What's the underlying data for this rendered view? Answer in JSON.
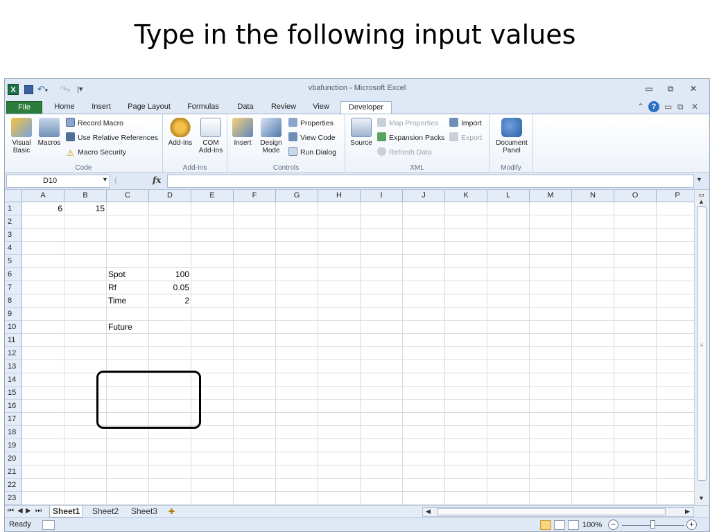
{
  "slide": {
    "title": "Type in the following input values"
  },
  "window": {
    "title": "vbafunction - Microsoft Excel",
    "quick_access": {
      "app_icon": "X",
      "undo_arrow": "▾",
      "redo_arrow": "▾",
      "customize": "|▾"
    },
    "controls": {
      "minimize": "▭",
      "restore": "⧉",
      "close": "✕"
    }
  },
  "ribbon": {
    "tabs": [
      {
        "label": "File"
      },
      {
        "label": "Home"
      },
      {
        "label": "Insert"
      },
      {
        "label": "Page Layout"
      },
      {
        "label": "Formulas"
      },
      {
        "label": "Data"
      },
      {
        "label": "Review"
      },
      {
        "label": "View"
      },
      {
        "label": "Developer"
      }
    ],
    "active_tab": "Developer",
    "right_controls": {
      "minimize_ribbon": "⌃",
      "help": "?",
      "doc_min": "▭",
      "doc_restore": "⧉",
      "doc_close": "✕"
    },
    "groups": {
      "code": {
        "label": "Code",
        "visual_basic": "Visual Basic",
        "macros": "Macros",
        "record_macro": "Record Macro",
        "relative_refs": "Use Relative References",
        "macro_security": "Macro Security"
      },
      "addins": {
        "label": "Add-Ins",
        "addins_btn": "Add-Ins",
        "com_addins": "COM Add-Ins"
      },
      "controls": {
        "label": "Controls",
        "insert": "Insert",
        "design_mode": "Design Mode",
        "properties": "Properties",
        "view_code": "View Code",
        "run_dialog": "Run Dialog"
      },
      "xml": {
        "label": "XML",
        "source": "Source",
        "map_properties": "Map Properties",
        "expansion_packs": "Expansion Packs",
        "refresh_data": "Refresh Data",
        "import": "Import",
        "export": "Export"
      },
      "modify": {
        "label": "Modify",
        "document_panel": "Document Panel"
      }
    }
  },
  "formula_bar": {
    "name_box": "D10",
    "fx_label": "fx",
    "formula": ""
  },
  "sheet": {
    "columns": [
      "A",
      "B",
      "C",
      "D",
      "E",
      "F",
      "G",
      "H",
      "I",
      "J",
      "K",
      "L",
      "M",
      "N",
      "O",
      "P"
    ],
    "rows": [
      "1",
      "2",
      "3",
      "4",
      "5",
      "6",
      "7",
      "8",
      "9",
      "10",
      "11",
      "12",
      "13",
      "14",
      "15",
      "16",
      "17",
      "18",
      "19",
      "20",
      "21",
      "22",
      "23"
    ],
    "cells": {
      "A1": "6",
      "B1": "15",
      "C6": "Spot",
      "D6": "100",
      "C7": "Rf",
      "D7": "0.05",
      "C8": "Time",
      "D8": "2",
      "C10": "Future"
    }
  },
  "sheet_tabs": [
    {
      "label": "Sheet1",
      "active": true
    },
    {
      "label": "Sheet2",
      "active": false
    },
    {
      "label": "Sheet3",
      "active": false
    }
  ],
  "status_bar": {
    "status": "Ready",
    "zoom": "100%",
    "zoom_fraction": 0.5
  },
  "colors": {
    "file_tab": "#2a7d3a",
    "header_bg": "#e4ecf7",
    "ribbon_bg": "#dfe8f5"
  }
}
